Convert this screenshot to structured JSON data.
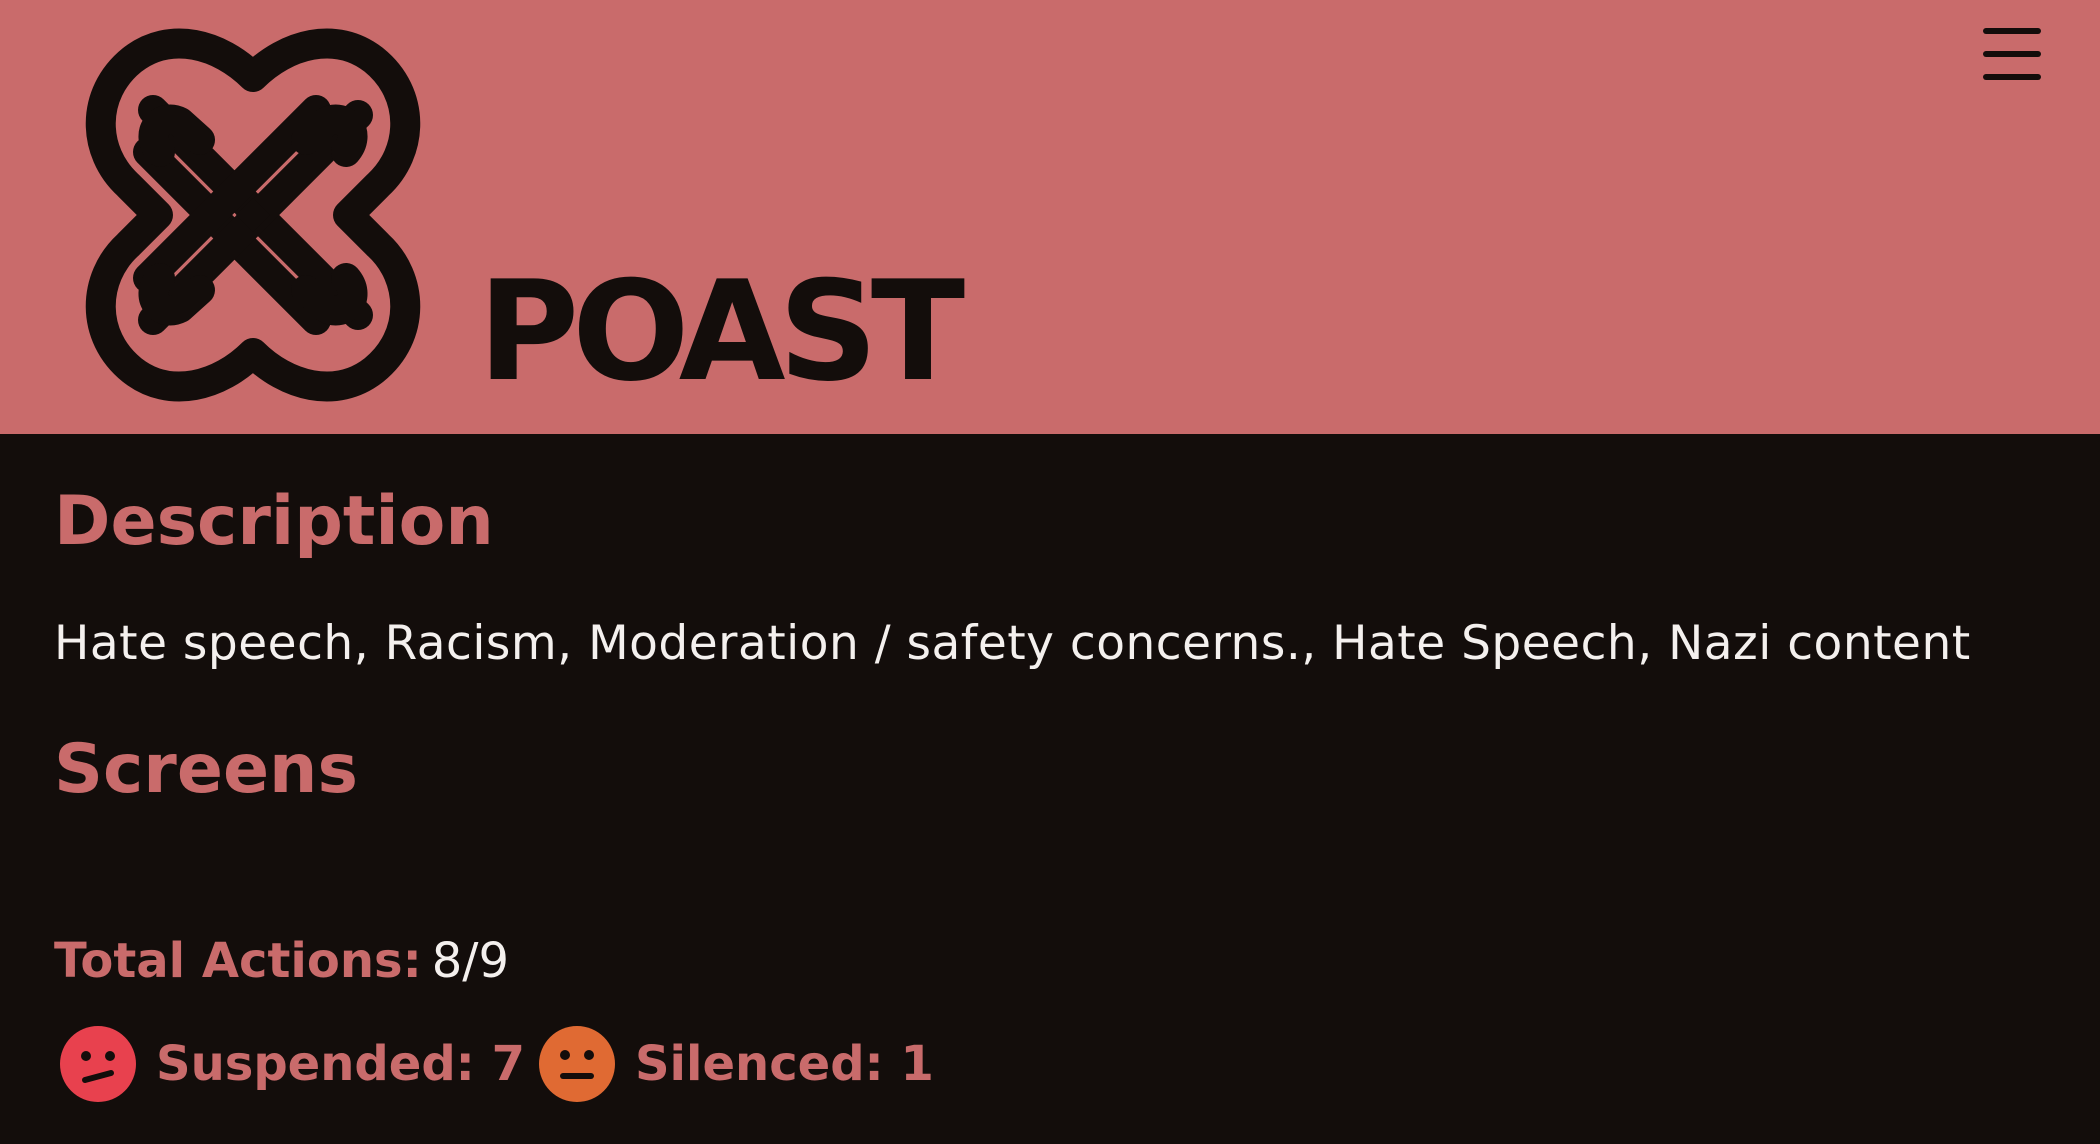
{
  "header": {
    "brand": "POAST",
    "logo_icon": "knot-logo-icon",
    "menu_icon": "hamburger-menu-icon",
    "background_color": "#c96b6b"
  },
  "description": {
    "heading": "Description",
    "text": "Hate speech, Racism, Moderation / safety concerns., Hate Speech, Nazi content"
  },
  "screens": {
    "heading": "Screens"
  },
  "totals": {
    "label": "Total Actions:",
    "value": "8/9"
  },
  "actions": [
    {
      "label": "Suspended: 7",
      "icon": "confused-face-icon",
      "color": "#e8414e"
    },
    {
      "label": "Silenced: 1",
      "icon": "neutral-face-icon",
      "color": "#e06a33"
    }
  ],
  "colors": {
    "accent": "#c96b6b",
    "page_background": "#130d0b",
    "text": "#f4f0ee"
  }
}
